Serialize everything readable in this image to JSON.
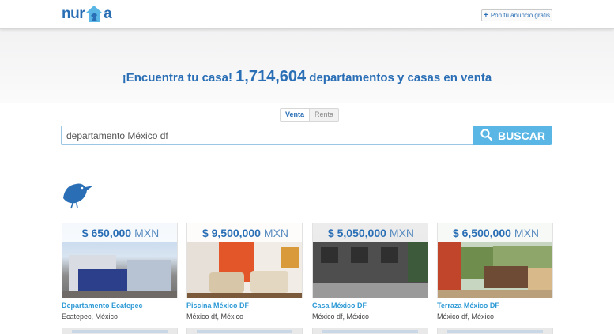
{
  "brand": {
    "logo_left": "nur",
    "logo_right": "a"
  },
  "header": {
    "post_ad_label": "Pon tu anuncio gratis"
  },
  "hero": {
    "headline_pre": "¡Encuentra tu casa!",
    "headline_count": "1,714,604",
    "headline_post": "departamentos y casas en venta"
  },
  "tabs": [
    "Venta",
    "Renta"
  ],
  "search": {
    "value": "departamento México df",
    "button_label": "BUSCAR"
  },
  "listings": [
    {
      "price": "$ 650,000",
      "currency": "MXN",
      "title": "Departamento Ecatepec",
      "location": "Ecatepec, México"
    },
    {
      "price": "$ 9,500,000",
      "currency": "MXN",
      "title": "Piscina México DF",
      "location": "México df, México"
    },
    {
      "price": "$ 5,050,000",
      "currency": "MXN",
      "title": "Casa México DF",
      "location": "México df, México"
    },
    {
      "price": "$ 6,500,000",
      "currency": "MXN",
      "title": "Terraza México DF",
      "location": "México df, México"
    }
  ],
  "colors": {
    "brand_blue": "#2a6fb6",
    "button_blue": "#5ab6e4",
    "link_blue": "#2e9ad6"
  }
}
